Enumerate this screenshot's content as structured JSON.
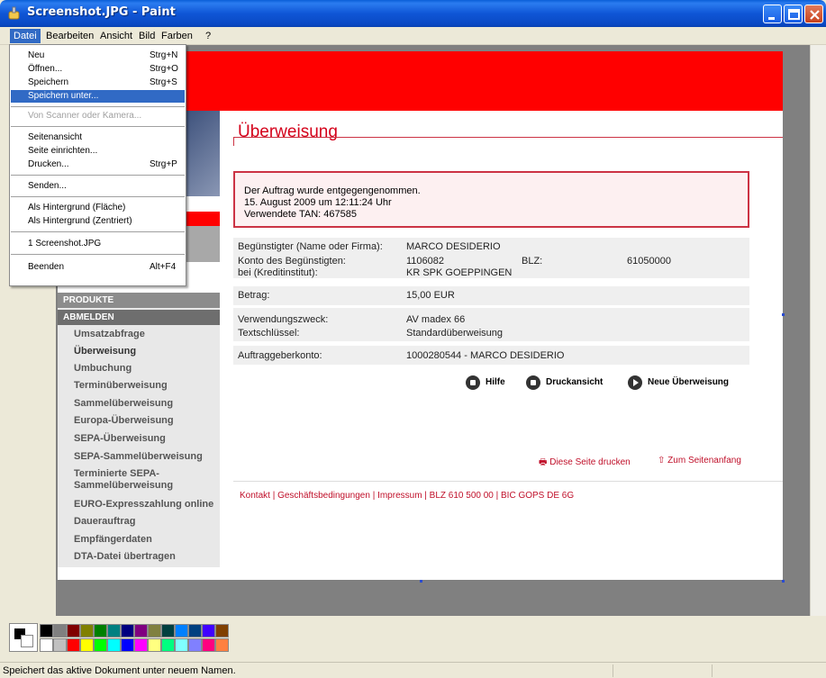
{
  "window": {
    "title": "Screenshot.JPG - Paint"
  },
  "menubar": [
    "Datei",
    "Bearbeiten",
    "Ansicht",
    "Bild",
    "Farben",
    "?"
  ],
  "file_menu": [
    {
      "label": "Neu",
      "shortcut": "Strg+N"
    },
    {
      "label": "Öffnen...",
      "shortcut": "Strg+O"
    },
    {
      "label": "Speichern",
      "shortcut": "Strg+S"
    },
    {
      "label": "Speichern unter...",
      "shortcut": ""
    },
    {
      "label": "Von Scanner oder Kamera...",
      "shortcut": ""
    },
    {
      "label": "Seitenansicht",
      "shortcut": ""
    },
    {
      "label": "Seite einrichten...",
      "shortcut": ""
    },
    {
      "label": "Drucken...",
      "shortcut": "Strg+P"
    },
    {
      "label": "Senden...",
      "shortcut": ""
    },
    {
      "label": "Als Hintergrund (Fläche)",
      "shortcut": ""
    },
    {
      "label": "Als Hintergrund (Zentriert)",
      "shortcut": ""
    },
    {
      "label": "1 Screenshot.JPG",
      "shortcut": ""
    },
    {
      "label": "Beenden",
      "shortcut": "Alt+F4"
    }
  ],
  "bank": {
    "heading": "Überweisung",
    "notice": [
      "Der Auftrag wurde entgegengenommen.",
      "15. August 2009 um 12:11:24 Uhr",
      "Verwendete TAN: 467585"
    ],
    "rows": {
      "beguenstigter_label": "Begünstigter (Name oder Firma):",
      "beguenstigter_value": "MARCO DESIDERIO",
      "konto_label": "Konto des Begünstigten:",
      "konto_value": "1106082",
      "blz_label": "BLZ:",
      "blz_value": "61050000",
      "institut_label": "bei (Kreditinstitut):",
      "institut_value": "KR SPK GOEPPINGEN",
      "betrag_label": "Betrag:",
      "betrag_value": "15,00 EUR",
      "zweck_label": "Verwendungszweck:",
      "zweck_value": "AV madex 66",
      "schluessel_label": "Textschlüssel:",
      "schluessel_value": "Standardüberweisung",
      "auftraggeber_label": "Auftraggeberkonto:",
      "auftraggeber_value": "1000280544 - MARCO DESIDERIO"
    },
    "actions": {
      "hilfe": "Hilfe",
      "druck": "Druckansicht",
      "neu": "Neue Überweisung"
    },
    "print_page": "Diese Seite drucken",
    "to_top": "Zum Seitenanfang",
    "footer": "Kontakt   |   Geschäftsbedingungen   |   Impressum   |   BLZ 610 500 00   |   BIC GOPS DE 6G",
    "sidebar_heads": [
      "PRODUKTE",
      "ABMELDEN"
    ],
    "sidebar_items": [
      "Umsatzabfrage",
      "Überweisung",
      "Umbuchung",
      "Terminüberweisung",
      "Sammelüberweisung",
      "Europa-Überweisung",
      "SEPA-Überweisung",
      "SEPA-Sammelüberweisung",
      "Terminierte SEPA-",
      "Sammelüberweisung",
      "EURO-Expresszahlung online",
      "Dauerauftrag",
      "Empfängerdaten",
      "DTA-Datei übertragen"
    ]
  },
  "palette": {
    "top": [
      "#000000",
      "#808080",
      "#800000",
      "#808000",
      "#008000",
      "#008080",
      "#000080",
      "#800080",
      "#808040",
      "#004040",
      "#0080ff",
      "#004080",
      "#4000ff",
      "#804000"
    ],
    "bottom": [
      "#ffffff",
      "#c0c0c0",
      "#ff0000",
      "#ffff00",
      "#00ff00",
      "#00ffff",
      "#0000ff",
      "#ff00ff",
      "#ffff80",
      "#00ff80",
      "#80ffff",
      "#8080ff",
      "#ff0080",
      "#ff8040"
    ]
  },
  "status": {
    "text": "Speichert das aktive Dokument unter neuem Namen."
  }
}
